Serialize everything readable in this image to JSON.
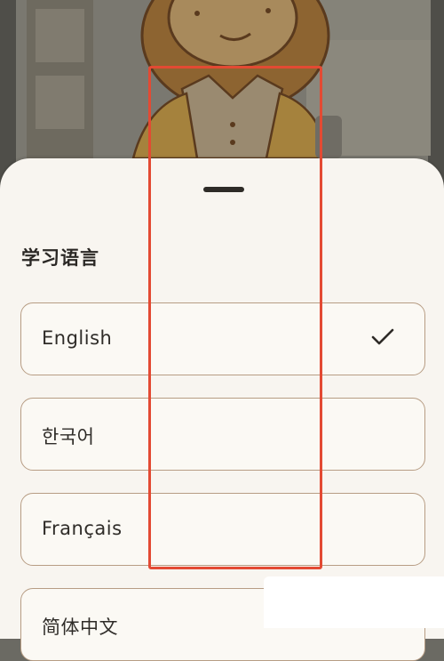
{
  "background": {
    "scene": "illustrated-character"
  },
  "sheet": {
    "title": "学习语言",
    "options": [
      {
        "label": "English",
        "selected": true
      },
      {
        "label": "한국어",
        "selected": false
      },
      {
        "label": "Français",
        "selected": false
      },
      {
        "label": "简体中文",
        "selected": false
      }
    ]
  },
  "icons": {
    "selected": "check-icon"
  },
  "colors": {
    "sheet_bg": "#f8f5f0",
    "option_border": "#b79d84",
    "highlight": "#e34a33"
  }
}
